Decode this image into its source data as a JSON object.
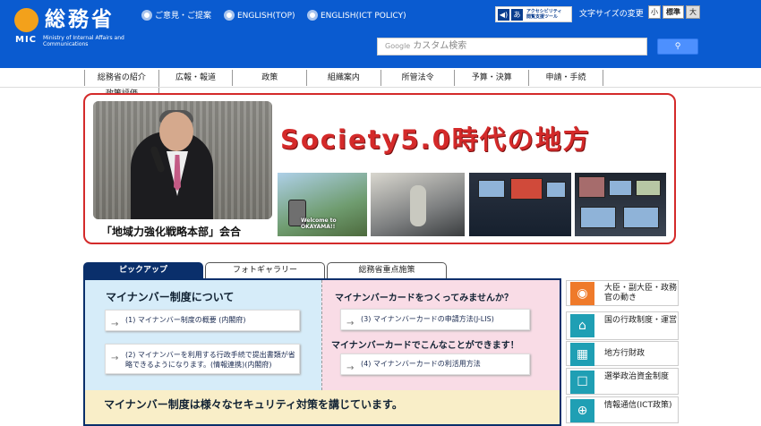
{
  "header": {
    "logo_title": "総務省",
    "logo_mic": "MIC",
    "logo_sub": "Ministry of Internal Affairs and Communications",
    "links": [
      {
        "label": "ご意見・ご提案"
      },
      {
        "label": "ENGLISH(TOP)"
      },
      {
        "label": "ENGLISH(ICT POLICY)"
      }
    ],
    "accessibility": {
      "line1": "アクセシビリティ",
      "line2": "閲覧支援ツール"
    },
    "font_size": {
      "label": "文字サイズの変更",
      "small": "小",
      "standard": "標準",
      "large": "大"
    },
    "search": {
      "brand": "Google",
      "placeholder": "カスタム検索",
      "button_icon": "search-icon"
    }
  },
  "nav": [
    "総務省の紹介",
    "広報・報道",
    "政策",
    "組織案内",
    "所管法令",
    "予算・決算",
    "申請・手続",
    "政策評価"
  ],
  "banner": {
    "title": "Society5.0時代の地方",
    "photo_caption": "「地域力強化戦略本部」会合",
    "thumb_text": [
      "Welcome",
      "to",
      "OKAYAMA!!"
    ]
  },
  "tabs": [
    "ピックアップ",
    "フォトギャラリー",
    "総務省重点施策"
  ],
  "pickup": {
    "left": {
      "heading": "マイナンバー制度について",
      "links": [
        "(1) マイナンバー制度の概要 (内閣府)",
        "(2) マイナンバーを利用する行政手続で提出書類が省略できるようになります。(情報連携)(内閣府)"
      ]
    },
    "right": {
      "heading1": "マイナンバーカードをつくってみませんか？",
      "link1": "(3) マイナンバーカードの申請方法(J-LIS)",
      "heading2": "マイナンバーカードでこんなことができます！",
      "link2": "(4) マイナンバーカードの利活用方法"
    },
    "bottom": "マイナンバー制度は様々なセキュリティ対策を講じています。"
  },
  "side": [
    {
      "icon": "camera-icon",
      "label": "大臣・副大臣・政務官の動き"
    },
    {
      "icon": "building-icon",
      "label": "国の行政制度・運営"
    },
    {
      "icon": "buildings-icon",
      "label": "地方行財政"
    },
    {
      "icon": "ballot-box-icon",
      "label": "選挙政治資金制度"
    },
    {
      "icon": "globe-icon",
      "label": "情報通信(ICT政策)"
    }
  ],
  "colors": {
    "brand": "#0a5bd0",
    "accent": "#d42a2a",
    "tab_active": "#0a2f6b",
    "icon_teal": "#1f9fb4",
    "icon_orange": "#ef7a2a"
  }
}
